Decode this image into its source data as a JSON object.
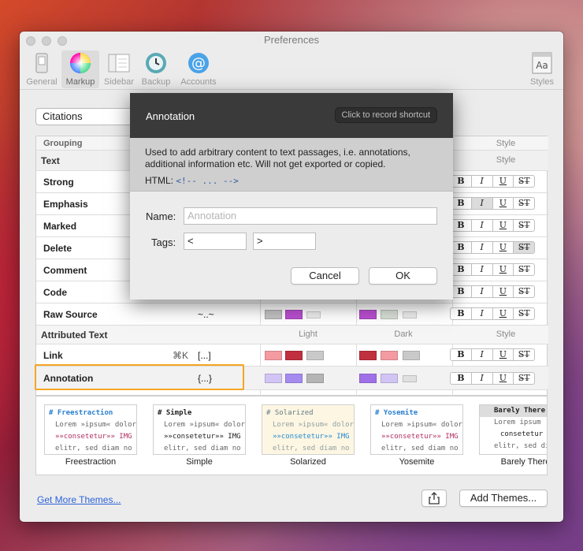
{
  "window": {
    "title": "Preferences"
  },
  "toolbar": {
    "items": [
      {
        "label": "General",
        "icon": "general-icon"
      },
      {
        "label": "Markup",
        "icon": "markup-icon"
      },
      {
        "label": "Sidebar",
        "icon": "sidebar-icon"
      },
      {
        "label": "Backup",
        "icon": "backup-icon"
      },
      {
        "label": "Accounts",
        "icon": "accounts-icon"
      }
    ],
    "right_item": {
      "label": "Styles",
      "icon": "styles-icon",
      "glyph": "Aa"
    }
  },
  "dropdown": {
    "value": "Citations"
  },
  "table": {
    "top_row": {
      "name": "Grouping",
      "style_header": "Style"
    },
    "section_text": {
      "label": "Text",
      "style_header": "Style"
    },
    "rows": [
      {
        "name": "Strong"
      },
      {
        "name": "Emphasis"
      },
      {
        "name": "Marked"
      },
      {
        "name": "Delete"
      },
      {
        "name": "Comment"
      },
      {
        "name": "Code"
      },
      {
        "name": "Raw Source",
        "tag": "~..~"
      }
    ],
    "section_attr": {
      "label": "Attributed Text",
      "light": "Light",
      "dark": "Dark",
      "style": "Style"
    },
    "attr_rows": [
      {
        "name": "Link",
        "key": "⌘K",
        "tag": "[...]"
      },
      {
        "name": "Annotation",
        "tag": "{...}"
      }
    ],
    "style_buttons": [
      "B",
      "I",
      "U",
      "S̶T̶"
    ]
  },
  "themes": [
    {
      "name": "Freestraction",
      "heading": "# Freestraction",
      "line1": "Lorem »ipsum« dolor",
      "line2": "»»consetetur»» IMG",
      "line3": "elitr, sed diam no"
    },
    {
      "name": "Simple",
      "heading": "# Simple",
      "line1": "Lorem »ipsum« dolor",
      "line2": "»»consetetur»» IMG",
      "line3": "elitr, sed diam no"
    },
    {
      "name": "Solarized",
      "heading": "# Solarized",
      "line1": "Lorem »ipsum« dolor",
      "line2": "»»consetetur»» IMG",
      "line3": "elitr, sed diam no"
    },
    {
      "name": "Yosemite",
      "heading": "# Yosemite",
      "line1": "Lorem »ipsum« dolor",
      "line2": "»»consetetur»» IMG",
      "line3": "elitr, sed diam no"
    },
    {
      "name": "Barely There",
      "heading": "Barely There",
      "line1": "Lorem ipsum",
      "line2": "consetetur",
      "line3": "elitr, sed diam"
    }
  ],
  "footer": {
    "link": "Get More Themes...",
    "add_button": "Add Themes..."
  },
  "modal": {
    "title": "Annotation",
    "shortcut": "Click to record shortcut",
    "description": "Used to add arbitrary content to text passages, i.e. annotations, additional information etc. Will not get exported or copied.",
    "html_label": "HTML:",
    "html_code": "<!-- ... -->",
    "name_label": "Name:",
    "name_placeholder": "Annotation",
    "tags_label": "Tags:",
    "tag_open": "<",
    "tag_close": ">",
    "cancel": "Cancel",
    "ok": "OK"
  },
  "colors": {
    "link_light": [
      "#f49aa1",
      "#c0303e",
      "#c9c9c9"
    ],
    "link_dark": [
      "#c0303e",
      "#f49aa1",
      "#c9c9c9"
    ],
    "annot_light": [
      "#d2c5f5",
      "#a58bf0",
      "#b5b5b5"
    ],
    "annot_dark": [
      "#a070e8",
      "#d2c5f5",
      "#e0e0e0"
    ],
    "raw_light": [
      "#c2c2c2",
      "#b94fd0",
      "#ececec"
    ],
    "raw_dark": [
      "#b94fd0",
      "#d7dfd5",
      "#ececec"
    ],
    "highlight": "#f5a623"
  }
}
